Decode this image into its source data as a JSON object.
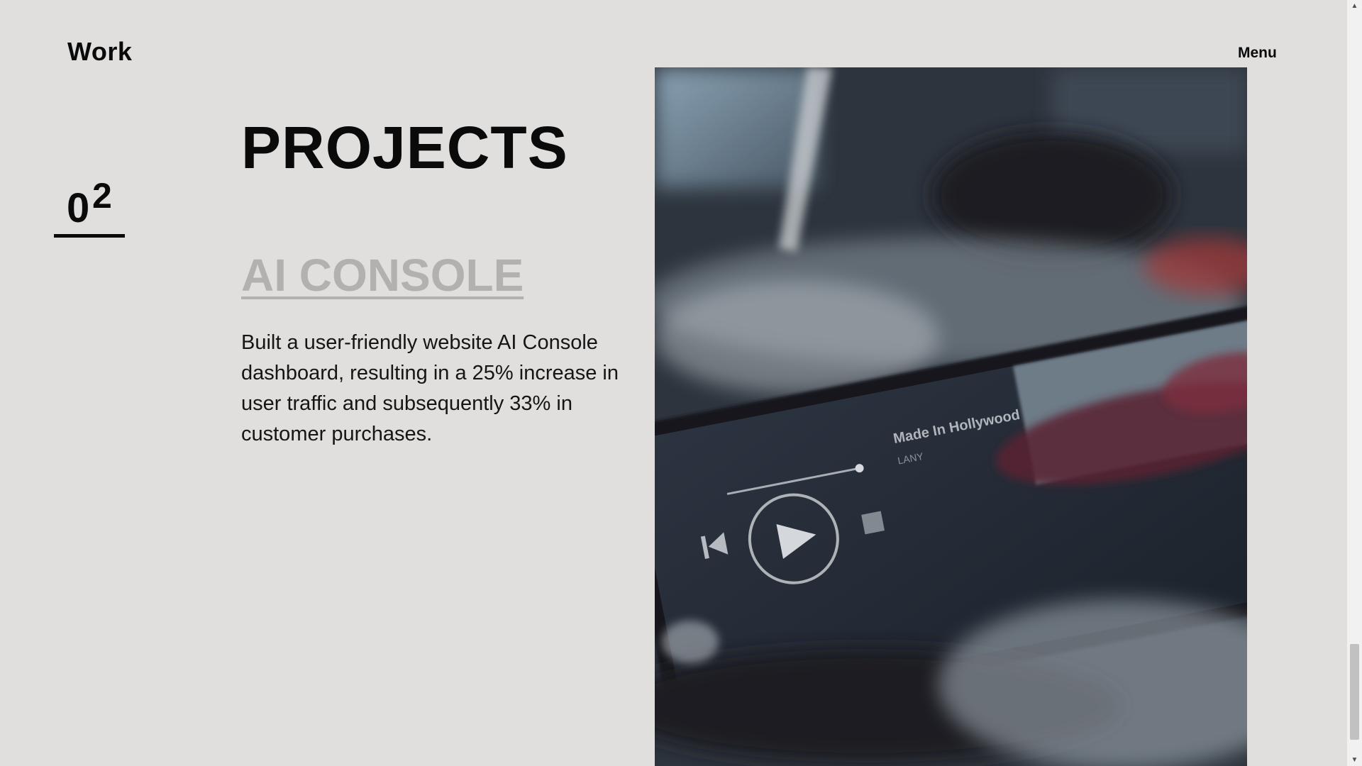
{
  "header": {
    "brand": "Work",
    "menu_label": "Menu"
  },
  "section": {
    "index_main": "0",
    "index_sup": "2",
    "heading": "PROJECTS"
  },
  "project": {
    "title": "AI CONSOLE",
    "description": "Built a user-friendly website AI Console dashboard, resulting in a 25% increase in user traffic and subsequently 33% in customer purchases.",
    "image": {
      "subject": "smartphone-music-player-photo",
      "screen_track": "Made In Hollywood"
    }
  },
  "colors": {
    "background": "#e0dfde",
    "text": "#0a0a0a",
    "muted_title": "#b2b1b0"
  },
  "scrollbar": {
    "up_glyph": "▲",
    "down_glyph": "▼"
  }
}
